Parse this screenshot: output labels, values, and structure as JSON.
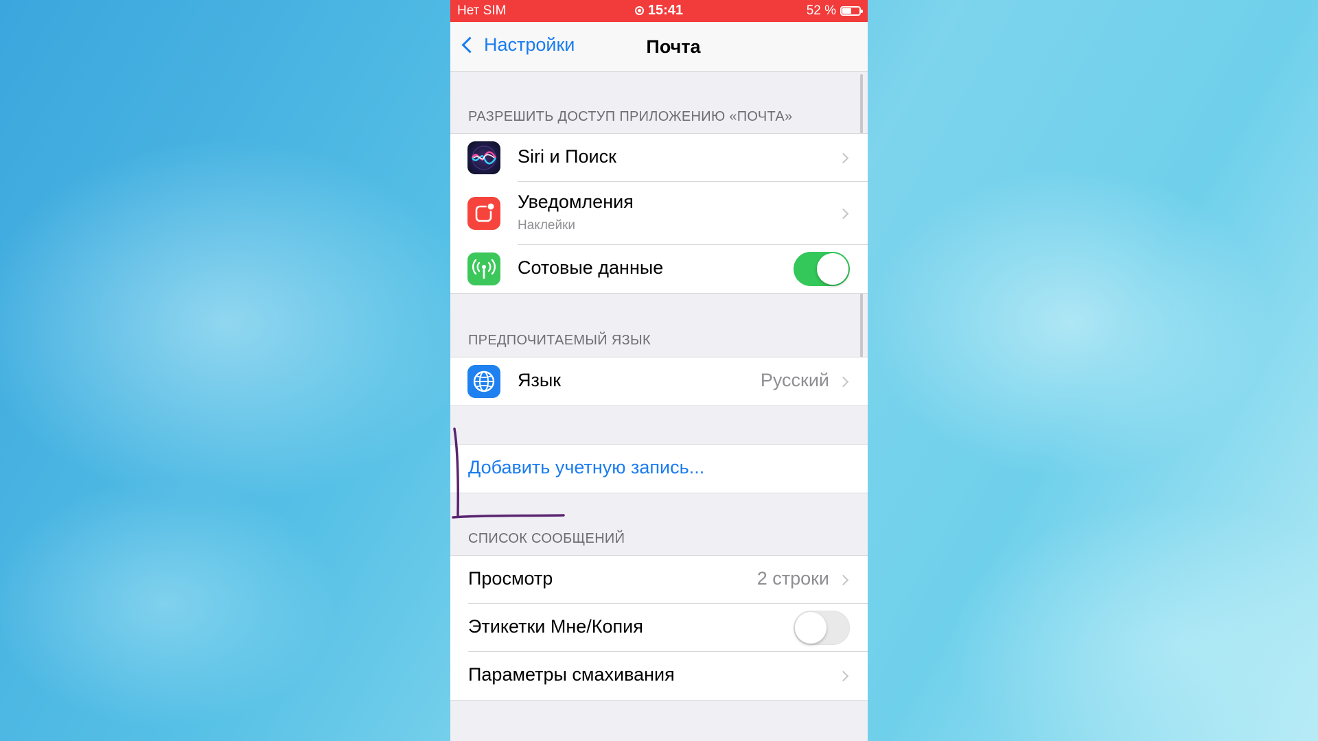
{
  "status_bar": {
    "carrier": "Нет SIM",
    "time": "15:41",
    "battery": "52 %"
  },
  "nav": {
    "back_label": "Настройки",
    "title": "Почта"
  },
  "sections": {
    "access_header": "РАЗРЕШИТЬ ДОСТУП ПРИЛОЖЕНИЮ «ПОЧТА»",
    "language_header": "ПРЕДПОЧИТАЕМЫЙ ЯЗЫК",
    "messages_header": "СПИСОК СООБЩЕНИЙ"
  },
  "access": {
    "siri_label": "Siri и Поиск",
    "notifications_label": "Уведомления",
    "notifications_sublabel": "Наклейки",
    "cellular_label": "Сотовые данные",
    "cellular_on": true
  },
  "language": {
    "label": "Язык",
    "value": "Русский"
  },
  "accounts": {
    "add_label": "Добавить учетную запись..."
  },
  "messages": {
    "preview_label": "Просмотр",
    "preview_value": "2 строки",
    "tolcc_label": "Этикетки Мне/Копия",
    "tolcc_on": false,
    "swipe_label": "Параметры смахивания"
  },
  "colors": {
    "status_bar": "#f23b3b",
    "accent": "#1a7cf0",
    "toggle_on": "#34c759",
    "annotation_stroke": "#5a2470"
  },
  "icons": {
    "siri": "siri-icon",
    "notifications": "notifications-icon",
    "cellular": "cellular-antenna-icon",
    "language": "globe-icon"
  }
}
